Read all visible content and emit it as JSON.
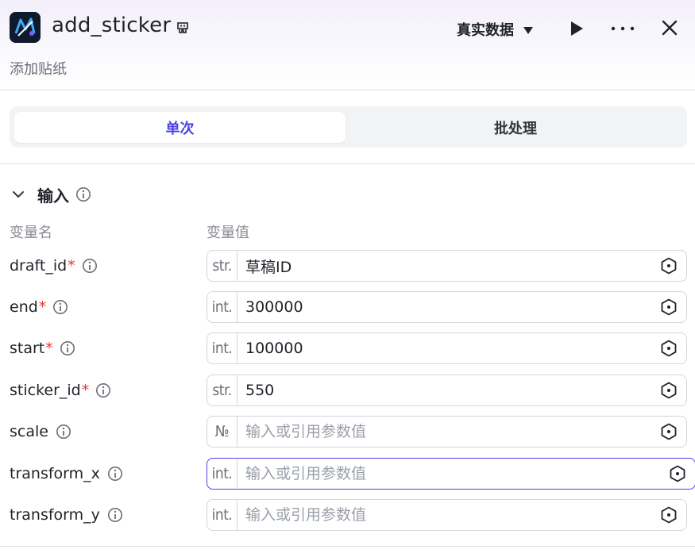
{
  "header": {
    "title": "add_sticker",
    "subtitle": "添加贴纸",
    "mode_label": "真实数据",
    "icons": {
      "logo": "app-logo",
      "title_icon": "plugin-icon",
      "run": "play-icon",
      "more": "more-icon",
      "close": "close-icon"
    }
  },
  "tabs": [
    {
      "label": "单次",
      "active": true
    },
    {
      "label": "批处理",
      "active": false
    }
  ],
  "section": {
    "title": "输入",
    "col_name": "变量名",
    "col_value": "变量值"
  },
  "params": [
    {
      "name": "draft_id",
      "required": "*",
      "type": "str.",
      "value": "草稿ID",
      "placeholder": "输入或引用参数值"
    },
    {
      "name": "end",
      "required": "*",
      "type": "int.",
      "value": "300000",
      "placeholder": "输入或引用参数值"
    },
    {
      "name": "start",
      "required": "*",
      "type": "int.",
      "value": "100000",
      "placeholder": "输入或引用参数值"
    },
    {
      "name": "sticker_id",
      "required": "*",
      "type": "str.",
      "value": "550",
      "placeholder": "输入或引用参数值"
    },
    {
      "name": "scale",
      "required": "",
      "type": "№",
      "value": "",
      "placeholder": "输入或引用参数值"
    },
    {
      "name": "transform_x",
      "required": "",
      "type": "int.",
      "value": "",
      "placeholder": "输入或引用参数值"
    },
    {
      "name": "transform_y",
      "required": "",
      "type": "int.",
      "value": "",
      "placeholder": "输入或引用参数值"
    }
  ],
  "colors": {
    "accent": "#4e40e5",
    "required": "#e53535"
  }
}
